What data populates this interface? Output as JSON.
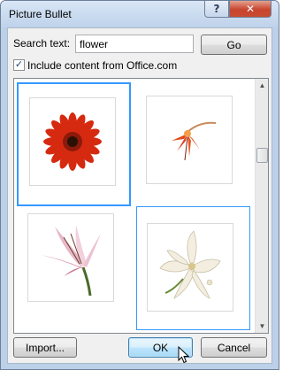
{
  "dialog": {
    "title": "Picture Bullet",
    "help_glyph": "?",
    "close_glyph": "✕"
  },
  "search": {
    "label": "Search text:",
    "value": "flower",
    "go_label": "Go"
  },
  "include_online": {
    "checked": true,
    "check_glyph": "✓",
    "label": "Include content from Office.com"
  },
  "gallery": {
    "items": [
      {
        "name": "red-gerbera-daisy",
        "state": "selected"
      },
      {
        "name": "orange-fuchsia",
        "state": "normal"
      },
      {
        "name": "pink-lily",
        "state": "normal"
      },
      {
        "name": "white-lily-bouquet",
        "state": "hover"
      }
    ],
    "scroll_up_glyph": "▲",
    "scroll_down_glyph": "▼"
  },
  "buttons": {
    "import_label": "Import...",
    "ok_label": "OK",
    "cancel_label": "Cancel"
  },
  "colors": {
    "selection": "#3399ff",
    "title_bar": "#bed2ea",
    "close_button": "#c8452f",
    "dialog_face": "#f0f0f0"
  }
}
